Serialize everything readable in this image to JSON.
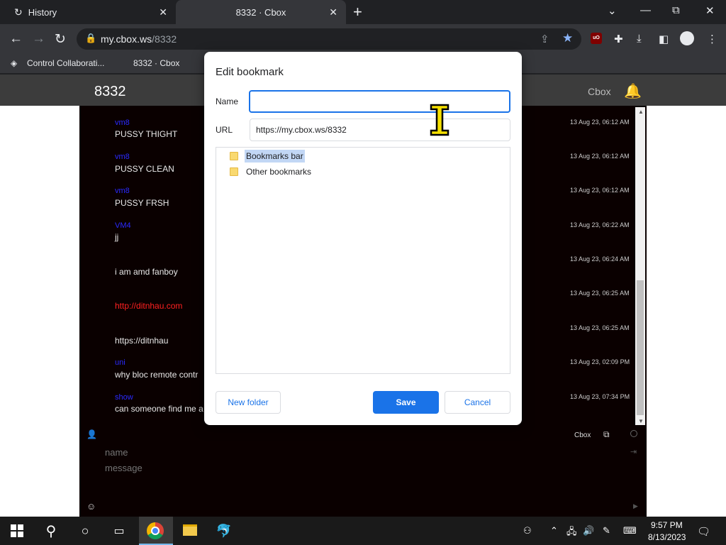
{
  "browser": {
    "tabs": [
      {
        "label": "History"
      },
      {
        "label": "8332 · Cbox"
      }
    ],
    "url_host": "my.cbox.ws",
    "url_path": "/8332",
    "bookmarks": [
      {
        "label": "Control Collaborati..."
      },
      {
        "label": "8332 · Cbox"
      }
    ],
    "icons": {
      "history": "↻",
      "close": "✕",
      "new_tab": "+",
      "minimize": "—",
      "maximize": "⧉",
      "window_close": "✕",
      "dropdown": "⌄",
      "back": "←",
      "forward": "→",
      "reload": "↻",
      "lock": "🔒",
      "share": "⇪",
      "star": "★",
      "ublock": "uO",
      "extensions": "✚",
      "download": "⤓",
      "side_panel": "◧",
      "menu": "⋮",
      "bm_app": "◈"
    }
  },
  "site": {
    "room": "8332",
    "cbox_link": "Cbox",
    "bell_icon": "🔔",
    "messages": [
      {
        "name": "vm8",
        "text": "PUSSY THIGHT",
        "time": "13 Aug 23, 06:12 AM"
      },
      {
        "name": "vm8",
        "text": "PUSSY CLEAN",
        "time": "13 Aug 23, 06:12 AM"
      },
      {
        "name": "vm8",
        "text": "PUSSY FRSH",
        "time": "13 Aug 23, 06:12 AM"
      },
      {
        "name": "VM4",
        "text": "jj",
        "time": "13 Aug 23, 06:22 AM"
      },
      {
        "name": "",
        "text": "i am amd fanboy",
        "time": "13 Aug 23, 06:24 AM"
      },
      {
        "name": "",
        "text": "http://ditnhau.com",
        "time": "13 Aug 23, 06:25 AM",
        "link": true
      },
      {
        "name": "",
        "text": "https://ditnhau",
        "time": "13 Aug 23, 06:25 AM"
      },
      {
        "name": "uni",
        "text": "why bloc remote contr",
        "time": "13 Aug 23, 02:09 PM"
      },
      {
        "name": "show",
        "text": "can someone find me a",
        "time": "13 Aug 23, 07:34 PM"
      }
    ],
    "footer": {
      "cbox_label": "Cbox",
      "name_placeholder": "name",
      "message_placeholder": "message"
    }
  },
  "dialog": {
    "title": "Edit bookmark",
    "name_label": "Name",
    "name_value": "",
    "url_label": "URL",
    "url_value": "https://my.cbox.ws/8332",
    "folders": [
      {
        "label": "Bookmarks bar",
        "selected": true
      },
      {
        "label": "Other bookmarks",
        "selected": false
      }
    ],
    "new_folder_label": "New folder",
    "save_label": "Save",
    "cancel_label": "Cancel",
    "accent": "#1a73e8"
  },
  "taskbar": {
    "time": "9:57 PM",
    "date": "8/13/2023"
  }
}
